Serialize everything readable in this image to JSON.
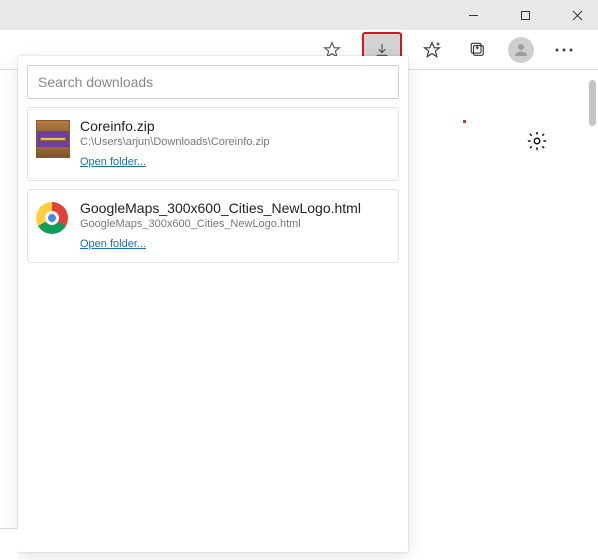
{
  "search": {
    "placeholder": "Search downloads"
  },
  "downloads": [
    {
      "name": "Coreinfo.zip",
      "path": "C:\\Users\\arjun\\Downloads\\Coreinfo.zip",
      "action": "Open folder..."
    },
    {
      "name": "GoogleMaps_300x600_Cities_NewLogo.html",
      "path": "GoogleMaps_300x600_Cities_NewLogo.html",
      "action": "Open folder..."
    }
  ]
}
